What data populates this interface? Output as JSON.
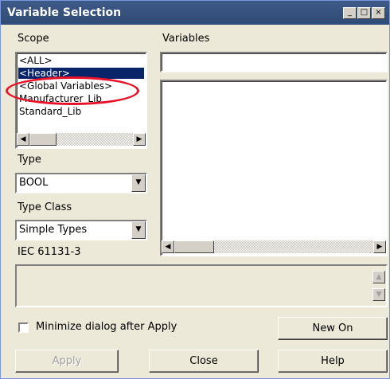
{
  "window": {
    "title": "Variable Selection",
    "minimize": "_",
    "maximize": "□",
    "close": "×"
  },
  "scope": {
    "label": "Scope",
    "items": [
      "<ALL>",
      "<Header>",
      "<Global Variables>",
      "Manufacturer_Lib",
      "Standard_Lib"
    ],
    "selected": "<Header>"
  },
  "variables": {
    "label": "Variables",
    "filter_value": ""
  },
  "type": {
    "label": "Type",
    "value": "BOOL"
  },
  "type_class": {
    "label": "Type Class",
    "value": "Simple Types"
  },
  "iec": {
    "label": "IEC 61131-3"
  },
  "options": {
    "minimize_label": "Minimize dialog after Apply",
    "minimize_checked": false
  },
  "buttons": {
    "new_on": "New On",
    "apply": "Apply",
    "close": "Close",
    "help": "Help"
  },
  "colors": {
    "title_bar": "#2e4a75",
    "selection": "#0a246a",
    "annotation": "#e8132a"
  }
}
